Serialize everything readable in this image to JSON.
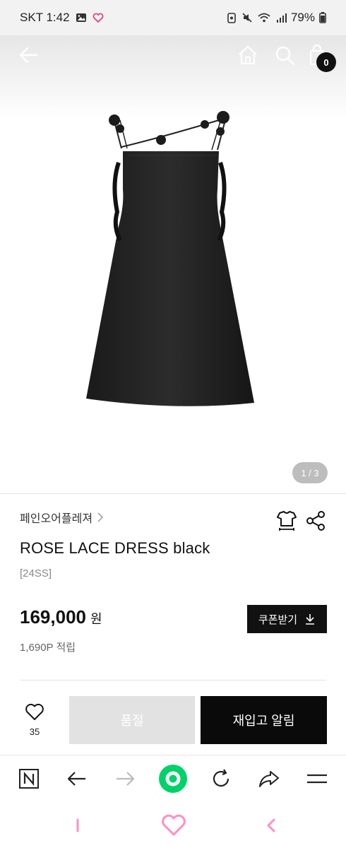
{
  "status_bar": {
    "carrier_time": "SKT 1:42",
    "battery": "79%"
  },
  "header": {
    "cart_count": "0"
  },
  "gallery": {
    "pager": "1 / 3"
  },
  "product": {
    "brand": "페인오어플레져",
    "name": "ROSE LACE DRESS black",
    "season": "[24SS]",
    "price": "169,000",
    "currency": "원",
    "points": "1,690P 적립",
    "coupon_label": "쿠폰받기"
  },
  "actions": {
    "wish_count": "35",
    "soldout_label": "품절",
    "restock_label": "재입고 알림"
  },
  "colors": {
    "accent_green": "#00d26a",
    "pink_heart": "#ff8fc4",
    "black": "#0a0a0a"
  },
  "icons": {
    "toolbar": [
      "naver-n-icon",
      "back-arrow-icon",
      "forward-arrow-icon",
      "green-home-circle-icon",
      "refresh-icon",
      "share-arrow-icon",
      "menu-icon"
    ],
    "system": [
      "recent-apps-icon",
      "home-heart-icon",
      "back-chevron-icon"
    ]
  }
}
